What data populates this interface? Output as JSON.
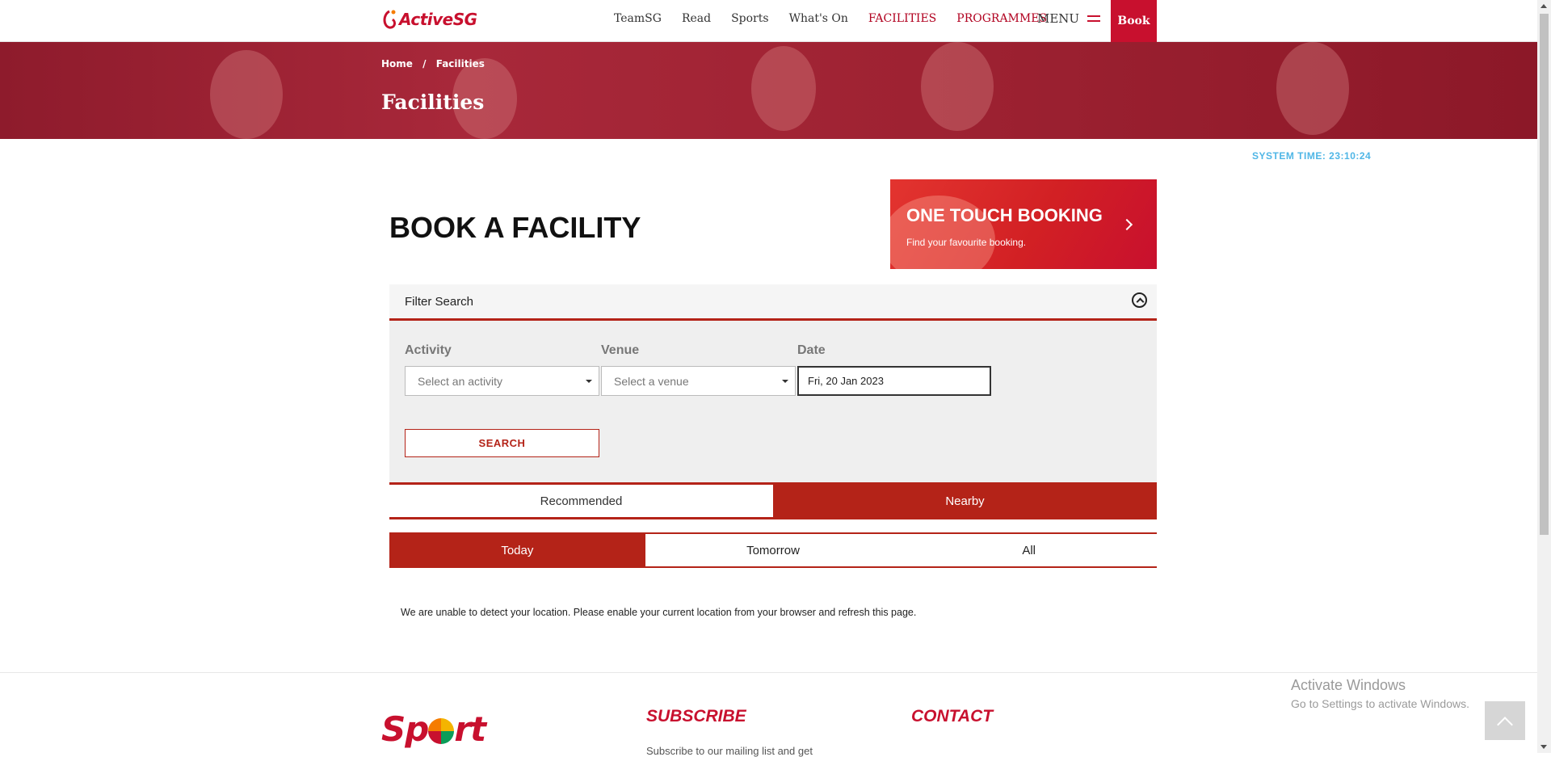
{
  "header": {
    "logo_text": "ActiveSG",
    "nav": [
      "TeamSG",
      "Read",
      "Sports",
      "What's On",
      "FACILITIES",
      "PROGRAMMES"
    ],
    "menu_label": "MENU",
    "book_label": "Book"
  },
  "hero": {
    "breadcrumb": [
      "Home",
      "Facilities"
    ],
    "title": "Facilities"
  },
  "system_time": "SYSTEM TIME: 23:10:24",
  "page_title": "BOOK A FACILITY",
  "one_touch": {
    "title": "ONE TOUCH BOOKING",
    "subtitle": "Find your favourite booking."
  },
  "filter": {
    "heading": "Filter Search",
    "activity_label": "Activity",
    "activity_value": "Select an activity",
    "venue_label": "Venue",
    "venue_value": "Select a venue",
    "date_label": "Date",
    "date_value": "Fri, 20 Jan 2023",
    "search_label": "SEARCH"
  },
  "tabs_primary": [
    "Recommended",
    "Nearby"
  ],
  "tabs_secondary": [
    "Today",
    "Tomorrow",
    "All"
  ],
  "location_message": "We are unable to detect your location. Please enable your current location from your browser and refresh this page.",
  "footer": {
    "logo_text_1": "Sp",
    "logo_text_2": "rt",
    "subscribe": "SUBSCRIBE",
    "subscribe_text": "Subscribe to our mailing list and get",
    "contact": "CONTACT"
  },
  "watermark": {
    "line1": "Activate Windows",
    "line2": "Go to Settings to activate Windows."
  },
  "colors": {
    "brand_red": "#c8102e",
    "tab_red": "#b42318",
    "system_time": "#4fb6e6"
  }
}
